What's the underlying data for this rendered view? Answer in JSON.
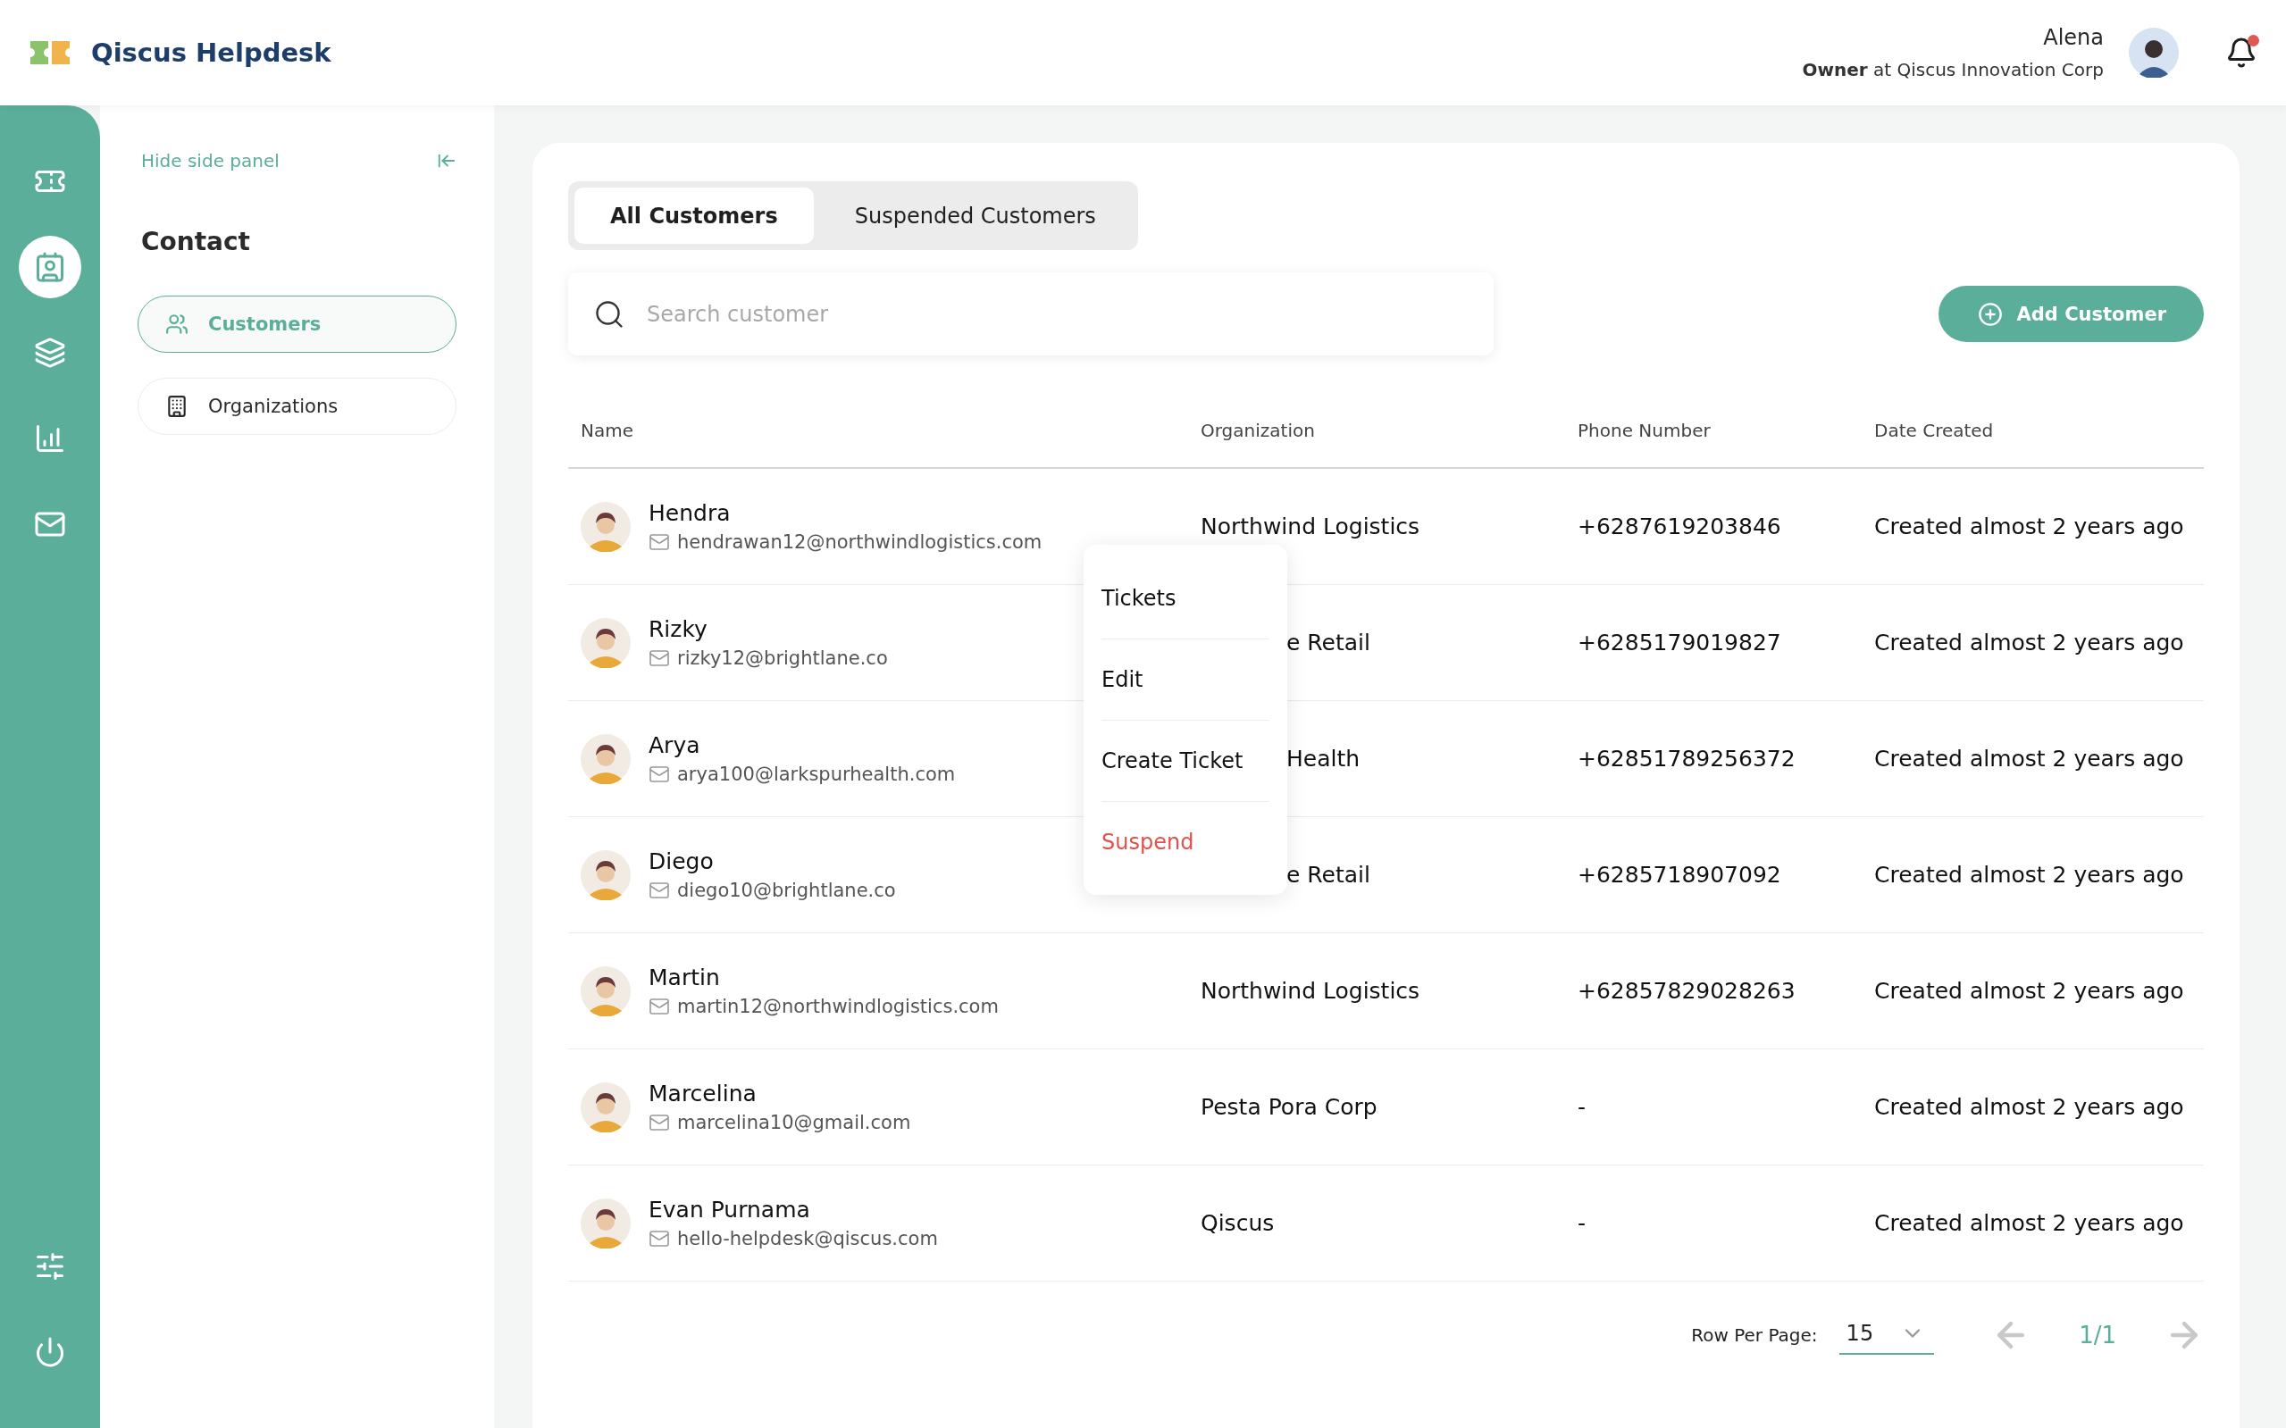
{
  "header": {
    "app_name": "Qiscus Helpdesk",
    "user_name": "Alena",
    "user_role": "**Owner** at Qiscus Innovation Corp",
    "notifications_unread": true
  },
  "rail": {
    "items": [
      {
        "kind": "ticket",
        "selected": false
      },
      {
        "kind": "contact",
        "selected": true
      },
      {
        "kind": "layers",
        "selected": false
      },
      {
        "kind": "chart",
        "selected": false
      },
      {
        "kind": "mail",
        "selected": false
      }
    ],
    "bottom_items": [
      {
        "kind": "settings",
        "selected": false
      },
      {
        "kind": "power",
        "selected": false
      }
    ]
  },
  "side_panel": {
    "hide_label": "Hide side panel",
    "title": "Contact",
    "items": [
      {
        "label": "Customers",
        "kind": "users",
        "selected": true
      },
      {
        "label": "Organizations",
        "kind": "building",
        "selected": false
      }
    ]
  },
  "tabs": [
    {
      "label": "All Customers",
      "selected": true
    },
    {
      "label": "Suspended Customers",
      "selected": false
    }
  ],
  "search": {
    "placeholder": "Search customer"
  },
  "add_button": "Add Customer",
  "table": {
    "columns": [
      "Name",
      "Organization",
      "Phone Number",
      "Date Created"
    ],
    "rows": [
      {
        "name": "Hendra",
        "email": "hendrawan12@northwindlogistics.com",
        "organization": "Northwind Logistics",
        "phone": "+6287619203846",
        "date": "Created almost 2 years ago"
      },
      {
        "name": "Rizky",
        "email": "rizky12@brightlane.co",
        "organization": "e Retail",
        "phone": "+6285179019827",
        "date": "Created almost 2 years ago",
        "occluded": true
      },
      {
        "name": "Arya",
        "email": "arya100@larkspurhealth.com",
        "organization": "Health",
        "phone": "+62851789256372",
        "date": "Created almost 2 years ago",
        "occluded": true
      },
      {
        "name": "Diego",
        "email": "diego10@brightlane.co",
        "organization": "e Retail",
        "phone": "+6285718907092",
        "date": "Created almost 2 years ago",
        "occluded": true
      },
      {
        "name": "Martin",
        "email": "martin12@northwindlogistics.com",
        "organization": "Northwind Logistics",
        "phone": "+62857829028263",
        "date": "Created almost 2 years ago"
      },
      {
        "name": "Marcelina",
        "email": "marcelina10@gmail.com",
        "organization": "Pesta Pora Corp",
        "phone": "-",
        "date": "Created almost 2 years ago"
      },
      {
        "name": "Evan Purnama",
        "email": "hello-helpdesk@qiscus.com",
        "organization": "Qiscus",
        "phone": "-",
        "date": "Created almost 2 years ago"
      }
    ]
  },
  "context_menu": {
    "items": [
      {
        "label": "Tickets",
        "kind": "normal"
      },
      {
        "label": "Edit",
        "kind": "normal"
      },
      {
        "label": "Create Ticket",
        "kind": "normal"
      },
      {
        "label": "Suspend",
        "kind": "danger"
      }
    ]
  },
  "pagination": {
    "rows_label": "Row Per Page:",
    "rows_value": "15",
    "page": "1/1"
  }
}
